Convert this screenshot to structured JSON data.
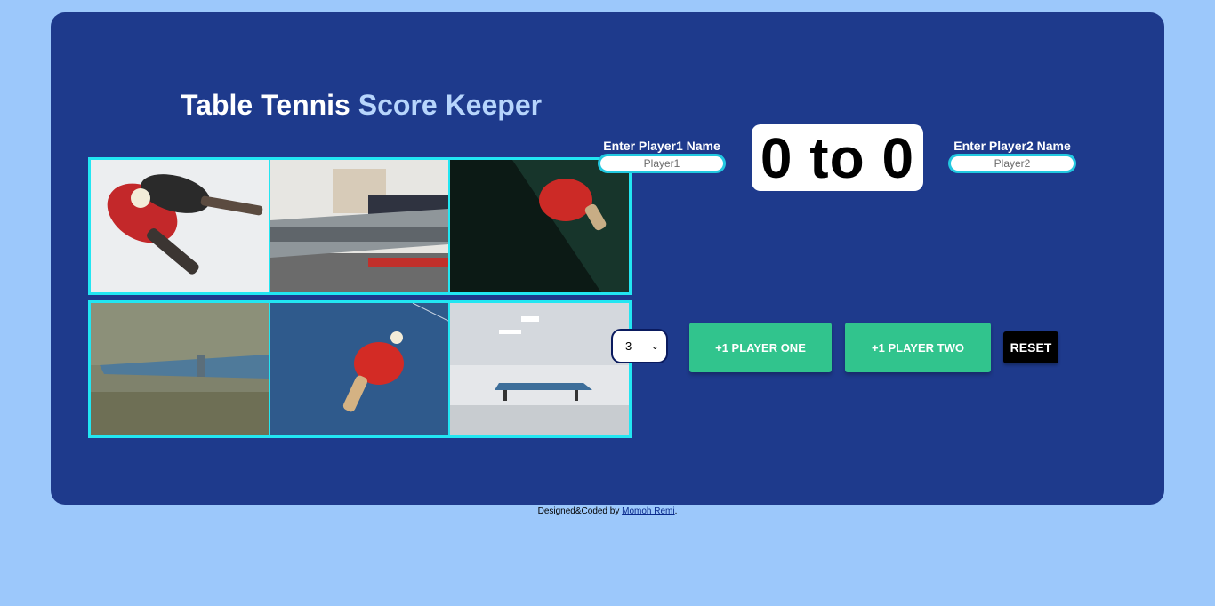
{
  "header": {
    "title_part1": "Table Tennis",
    "title_part2": "Score Keeper"
  },
  "gallery": {
    "images": [
      "paddles-and-ball-photo",
      "living-room-table-photo",
      "paddle-on-green-photo",
      "blurred-table-photo",
      "paddle-on-blue-photo",
      "white-room-table-photo"
    ]
  },
  "player1": {
    "label": "Enter Player1 Name",
    "placeholder": "Player1",
    "value": ""
  },
  "player2": {
    "label": "Enter Player2 Name",
    "placeholder": "Player2",
    "value": ""
  },
  "score": {
    "p1": "0",
    "separator": "to",
    "p2": "0"
  },
  "controls": {
    "winning_score_selected": "3",
    "btn_player_one": "+1 PLAYER ONE",
    "btn_player_two": "+1 PLAYER TWO",
    "btn_reset": "RESET"
  },
  "footer": {
    "prefix": "Designed&Coded by",
    "author": "Momoh Remi",
    "suffix": "."
  },
  "colors": {
    "page_bg": "#9cc8fb",
    "card_bg": "#1e3a8c",
    "accent_cyan": "#22e6f2",
    "button_green": "#31c48d",
    "title_accent": "#b7d5fc"
  }
}
